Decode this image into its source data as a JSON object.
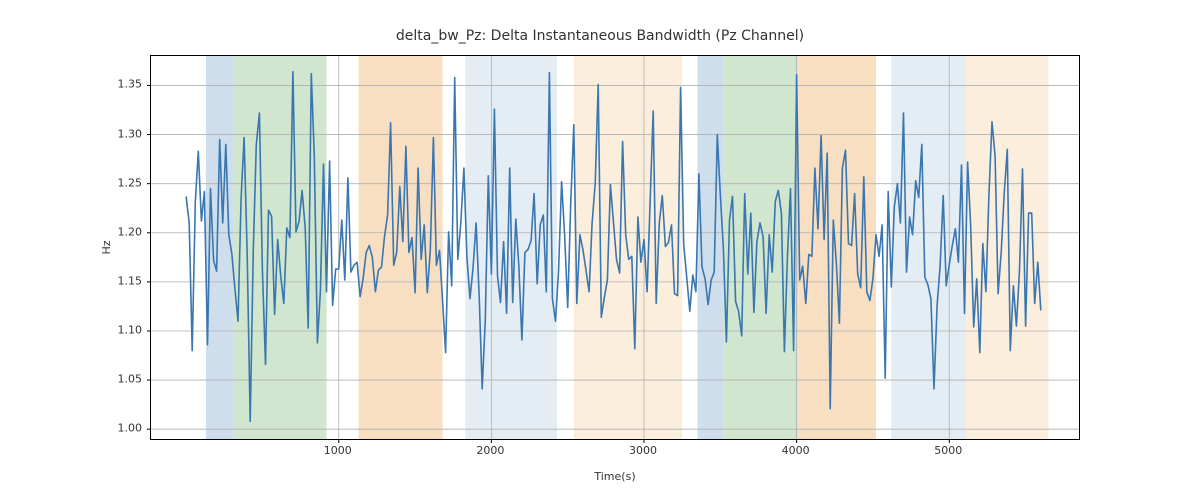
{
  "chart_data": {
    "type": "line",
    "title": "delta_bw_Pz: Delta Instantaneous Bandwidth (Pz Channel)",
    "xlabel": "Time(s)",
    "ylabel": "Hz",
    "xlim": [
      -230,
      5850
    ],
    "ylim": [
      0.99,
      1.38
    ],
    "xticks": [
      1000,
      2000,
      3000,
      4000,
      5000
    ],
    "yticks": [
      1.0,
      1.05,
      1.1,
      1.15,
      1.2,
      1.25,
      1.3,
      1.35
    ],
    "line_color": "#3a76af",
    "spans": [
      {
        "x0": 130,
        "x1": 310,
        "color": "#cedeec",
        "name": "band-blue-1"
      },
      {
        "x0": 310,
        "x1": 920,
        "color": "#d0e6cf",
        "name": "band-green-1"
      },
      {
        "x0": 1130,
        "x1": 1680,
        "color": "#f8dfc2",
        "name": "band-orange-1"
      },
      {
        "x0": 1830,
        "x1": 2430,
        "color": "#e4ecf4",
        "name": "band-lightblue-1"
      },
      {
        "x0": 2540,
        "x1": 3250,
        "color": "#fbeedc",
        "name": "band-lightorange-1"
      },
      {
        "x0": 3350,
        "x1": 3520,
        "color": "#cedeec",
        "name": "band-blue-2"
      },
      {
        "x0": 3520,
        "x1": 4010,
        "color": "#d0e6cf",
        "name": "band-green-2"
      },
      {
        "x0": 4010,
        "x1": 4520,
        "color": "#f8dfc2",
        "name": "band-orange-2"
      },
      {
        "x0": 4620,
        "x1": 5110,
        "color": "#e4ecf4",
        "name": "band-lightblue-2"
      },
      {
        "x0": 5110,
        "x1": 5650,
        "color": "#fbeedc",
        "name": "band-lightorange-2"
      }
    ],
    "x": [
      0,
      20,
      40,
      60,
      80,
      100,
      120,
      140,
      160,
      180,
      200,
      220,
      240,
      260,
      280,
      300,
      320,
      340,
      360,
      380,
      400,
      420,
      440,
      460,
      480,
      500,
      520,
      540,
      560,
      580,
      600,
      620,
      640,
      660,
      680,
      700,
      720,
      740,
      760,
      780,
      800,
      820,
      840,
      860,
      880,
      900,
      920,
      940,
      960,
      980,
      1000,
      1020,
      1040,
      1060,
      1080,
      1100,
      1120,
      1140,
      1160,
      1180,
      1200,
      1220,
      1240,
      1260,
      1280,
      1300,
      1320,
      1340,
      1360,
      1380,
      1400,
      1420,
      1440,
      1460,
      1480,
      1500,
      1520,
      1540,
      1560,
      1580,
      1600,
      1620,
      1640,
      1660,
      1680,
      1700,
      1720,
      1740,
      1760,
      1780,
      1800,
      1820,
      1840,
      1860,
      1880,
      1900,
      1920,
      1940,
      1960,
      1980,
      2000,
      2020,
      2040,
      2060,
      2080,
      2100,
      2120,
      2140,
      2160,
      2180,
      2200,
      2220,
      2240,
      2260,
      2280,
      2300,
      2320,
      2340,
      2360,
      2380,
      2400,
      2420,
      2440,
      2460,
      2480,
      2500,
      2520,
      2540,
      2560,
      2580,
      2600,
      2620,
      2640,
      2660,
      2680,
      2700,
      2720,
      2740,
      2760,
      2780,
      2800,
      2820,
      2840,
      2860,
      2880,
      2900,
      2920,
      2940,
      2960,
      2980,
      3000,
      3020,
      3040,
      3060,
      3080,
      3100,
      3120,
      3140,
      3160,
      3180,
      3200,
      3220,
      3240,
      3260,
      3280,
      3300,
      3320,
      3340,
      3360,
      3380,
      3400,
      3420,
      3440,
      3460,
      3480,
      3500,
      3520,
      3540,
      3560,
      3580,
      3600,
      3620,
      3640,
      3660,
      3680,
      3700,
      3720,
      3740,
      3760,
      3780,
      3800,
      3820,
      3840,
      3860,
      3880,
      3900,
      3920,
      3940,
      3960,
      3980,
      4000,
      4020,
      4040,
      4060,
      4080,
      4100,
      4120,
      4140,
      4160,
      4180,
      4200,
      4220,
      4240,
      4260,
      4280,
      4300,
      4320,
      4340,
      4360,
      4380,
      4400,
      4420,
      4440,
      4460,
      4480,
      4500,
      4520,
      4540,
      4560,
      4580,
      4600,
      4620,
      4640,
      4660,
      4680,
      4700,
      4720,
      4740,
      4760,
      4780,
      4800,
      4820,
      4840,
      4860,
      4880,
      4900,
      4920,
      4940,
      4960,
      4980,
      5000,
      5020,
      5040,
      5060,
      5080,
      5100,
      5120,
      5140,
      5160,
      5180,
      5200,
      5220,
      5240,
      5260,
      5280,
      5300,
      5320,
      5340,
      5360,
      5380,
      5400,
      5420,
      5440,
      5460,
      5480,
      5500,
      5520,
      5540,
      5560,
      5580,
      5600
    ],
    "values": [
      1.237,
      1.21,
      1.08,
      1.231,
      1.283,
      1.212,
      1.242,
      1.086,
      1.245,
      1.172,
      1.161,
      1.295,
      1.21,
      1.29,
      1.198,
      1.178,
      1.143,
      1.11,
      1.235,
      1.297,
      1.178,
      1.008,
      1.183,
      1.29,
      1.322,
      1.162,
      1.066,
      1.223,
      1.217,
      1.117,
      1.193,
      1.156,
      1.128,
      1.205,
      1.195,
      1.364,
      1.201,
      1.212,
      1.243,
      1.205,
      1.103,
      1.362,
      1.278,
      1.088,
      1.141,
      1.27,
      1.14,
      1.273,
      1.126,
      1.163,
      1.163,
      1.213,
      1.152,
      1.256,
      1.16,
      1.167,
      1.17,
      1.135,
      1.154,
      1.18,
      1.187,
      1.175,
      1.14,
      1.162,
      1.165,
      1.196,
      1.218,
      1.312,
      1.167,
      1.18,
      1.247,
      1.191,
      1.288,
      1.18,
      1.195,
      1.139,
      1.266,
      1.173,
      1.208,
      1.139,
      1.182,
      1.297,
      1.167,
      1.182,
      1.132,
      1.078,
      1.201,
      1.146,
      1.358,
      1.173,
      1.21,
      1.266,
      1.175,
      1.133,
      1.165,
      1.21,
      1.135,
      1.041,
      1.112,
      1.258,
      1.158,
      1.326,
      1.156,
      1.129,
      1.191,
      1.118,
      1.266,
      1.129,
      1.214,
      1.167,
      1.091,
      1.18,
      1.183,
      1.192,
      1.24,
      1.148,
      1.208,
      1.218,
      1.14,
      1.363,
      1.133,
      1.11,
      1.16,
      1.252,
      1.198,
      1.124,
      1.229,
      1.31,
      1.128,
      1.198,
      1.183,
      1.162,
      1.14,
      1.21,
      1.25,
      1.351,
      1.114,
      1.134,
      1.152,
      1.249,
      1.21,
      1.173,
      1.159,
      1.293,
      1.198,
      1.173,
      1.176,
      1.082,
      1.216,
      1.17,
      1.193,
      1.14,
      1.231,
      1.324,
      1.128,
      1.21,
      1.238,
      1.186,
      1.19,
      1.208,
      1.138,
      1.136,
      1.348,
      1.188,
      1.155,
      1.12,
      1.157,
      1.14,
      1.26,
      1.165,
      1.153,
      1.127,
      1.152,
      1.16,
      1.3,
      1.239,
      1.184,
      1.089,
      1.213,
      1.237,
      1.13,
      1.12,
      1.095,
      1.24,
      1.158,
      1.22,
      1.119,
      1.191,
      1.21,
      1.196,
      1.118,
      1.198,
      1.16,
      1.232,
      1.243,
      1.22,
      1.079,
      1.178,
      1.245,
      1.08,
      1.361,
      1.152,
      1.166,
      1.128,
      1.178,
      1.176,
      1.266,
      1.204,
      1.299,
      1.193,
      1.281,
      1.021,
      1.213,
      1.17,
      1.108,
      1.266,
      1.284,
      1.189,
      1.187,
      1.24,
      1.158,
      1.144,
      1.257,
      1.14,
      1.131,
      1.153,
      1.198,
      1.176,
      1.208,
      1.052,
      1.242,
      1.145,
      1.226,
      1.25,
      1.21,
      1.322,
      1.16,
      1.216,
      1.198,
      1.253,
      1.236,
      1.29,
      1.155,
      1.147,
      1.133,
      1.041,
      1.126,
      1.166,
      1.238,
      1.146,
      1.168,
      1.187,
      1.204,
      1.17,
      1.269,
      1.118,
      1.272,
      1.209,
      1.104,
      1.153,
      1.078,
      1.189,
      1.14,
      1.238,
      1.313,
      1.278,
      1.138,
      1.18,
      1.24,
      1.285,
      1.08,
      1.146,
      1.105,
      1.162,
      1.265,
      1.105,
      1.22,
      1.22,
      1.128,
      1.17,
      1.121
    ]
  }
}
